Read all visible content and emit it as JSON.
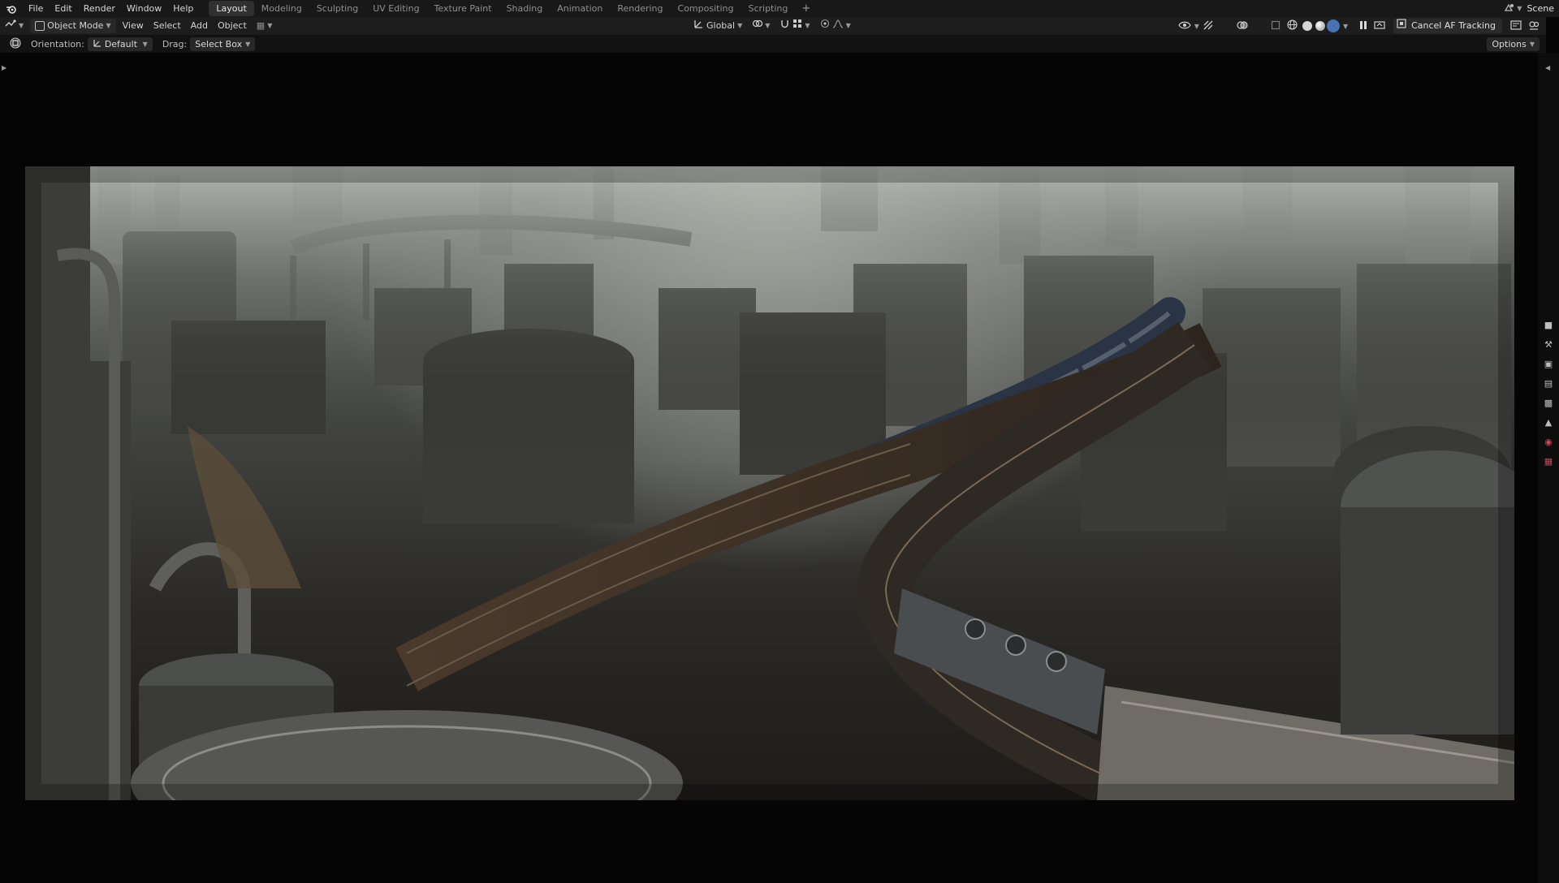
{
  "app": {
    "menu": [
      "File",
      "Edit",
      "Render",
      "Window",
      "Help"
    ],
    "workspaces": [
      "Layout",
      "Modeling",
      "Sculpting",
      "UV Editing",
      "Texture Paint",
      "Shading",
      "Animation",
      "Rendering",
      "Compositing",
      "Scripting"
    ],
    "active_workspace": "Layout",
    "scene_name": "Scene"
  },
  "header": {
    "mode": "Object Mode",
    "menus": [
      "View",
      "Select",
      "Add",
      "Object"
    ],
    "transform_orientation": "Global",
    "cancel_button": "Cancel AF Tracking"
  },
  "tool_settings": {
    "orientation_label": "Orientation:",
    "orientation_value": "Default",
    "drag_label": "Drag:",
    "drag_value": "Select Box",
    "options": "Options"
  },
  "colors": {
    "accent_blue": "#4772b3",
    "topbar_bg": "#181818",
    "header_bg": "#1d1d1d",
    "viewport_bg": "#050505"
  },
  "icons": [
    "blender-logo-icon",
    "editor-type-icon",
    "object-mode-icon",
    "global-orientation-icon",
    "pivot-icon",
    "snap-icon",
    "proportional-icon",
    "visibility-icon",
    "gizmo-icon",
    "overlay-icon",
    "xray-icon",
    "wireframe-shading-icon",
    "solid-shading-icon",
    "material-shading-icon",
    "rendered-shading-icon",
    "pause-icon",
    "tool-icon",
    "render-props-icon",
    "output-props-icon",
    "view-layer-icon",
    "scene-props-icon",
    "world-props-icon",
    "texture-props-icon"
  ]
}
